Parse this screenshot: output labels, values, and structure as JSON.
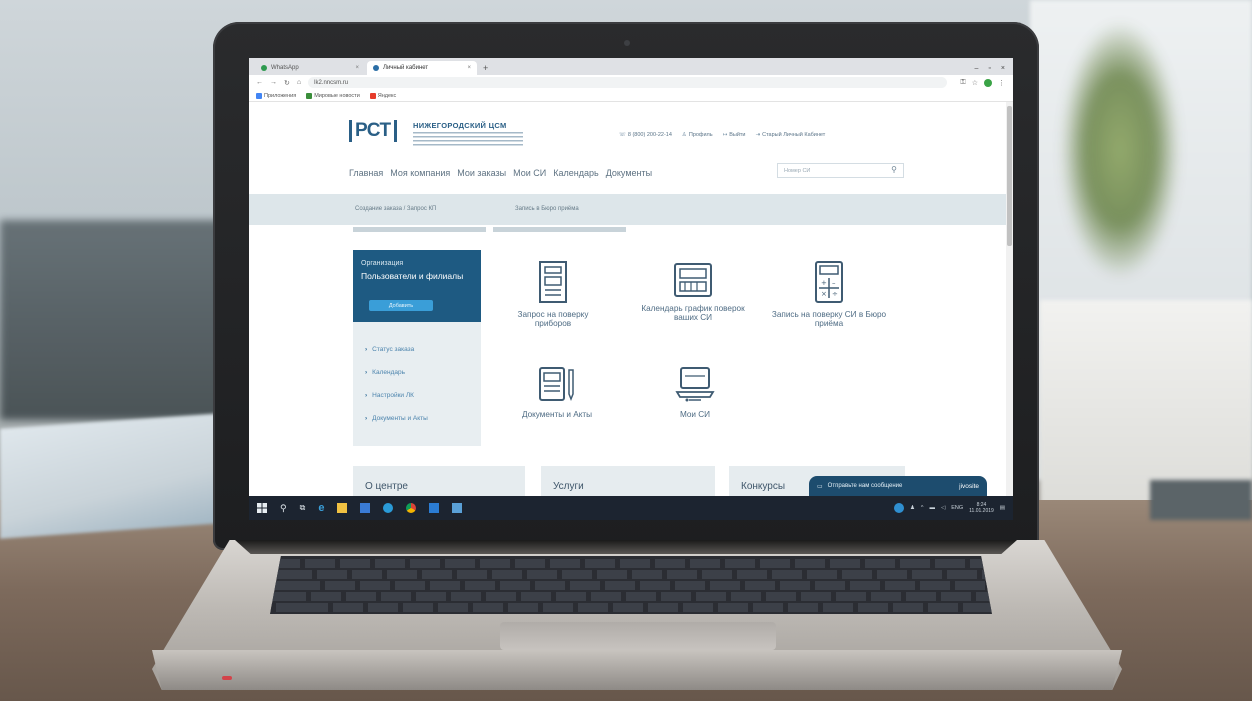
{
  "browser": {
    "tabs": [
      {
        "label": "WhatsApp",
        "active": false
      },
      {
        "label": "Личный кабинет",
        "active": true
      }
    ],
    "new_tab": "+",
    "address": "lk2.nncsm.ru",
    "bookmarks": [
      "Приложения",
      "Мировые новости",
      "Яндекс"
    ]
  },
  "site": {
    "logo": "РСТ",
    "org_name": "НИЖЕГОРОДСКИЙ ЦСМ",
    "top_links": {
      "phone": "8 (800) 200-22-14",
      "profile": "Профиль",
      "logout": "Выйти",
      "old_cabinet": "Старый Личный Кабинет"
    },
    "nav": [
      "Главная",
      "Моя компания",
      "Мои заказы",
      "Мои СИ",
      "Календарь",
      "Документы"
    ],
    "search_placeholder": "Номер СИ",
    "subnav": [
      "Создание заказа / Запрос КП",
      "Запись в Бюро приёма"
    ],
    "panel": {
      "org_label": "Организация",
      "title": "Пользователи и филиалы",
      "add_button": "Добавить",
      "links": [
        "Статус заказа",
        "Календарь",
        "Настройки ЛК",
        "Документы и Акты"
      ]
    },
    "tiles": [
      {
        "label": "Запрос на поверку приборов",
        "icon": "document-form-icon"
      },
      {
        "label": "Календарь график поверок ваших СИ",
        "icon": "calendar-device-icon"
      },
      {
        "label": "Запись на поверку СИ в Бюро приёма",
        "icon": "calculator-icon"
      },
      {
        "label": "Документы и Акты",
        "icon": "document-pen-icon"
      },
      {
        "label": "Мои СИ",
        "icon": "laptop-device-icon"
      }
    ],
    "bottom_cards": [
      "О центре",
      "Услуги",
      "Конкурсы"
    ],
    "chat": {
      "label": "Отправьте нам сообщение",
      "brand": "jivosite"
    }
  },
  "taskbar": {
    "lang": "ENG",
    "time": "8:24",
    "date": "11.01.2019"
  },
  "colors": {
    "brand_blue": "#1e5a82",
    "accent_blue": "#3a9ed8",
    "subnav_bg": "#dde6ea",
    "taskbar": "#1c2430"
  }
}
